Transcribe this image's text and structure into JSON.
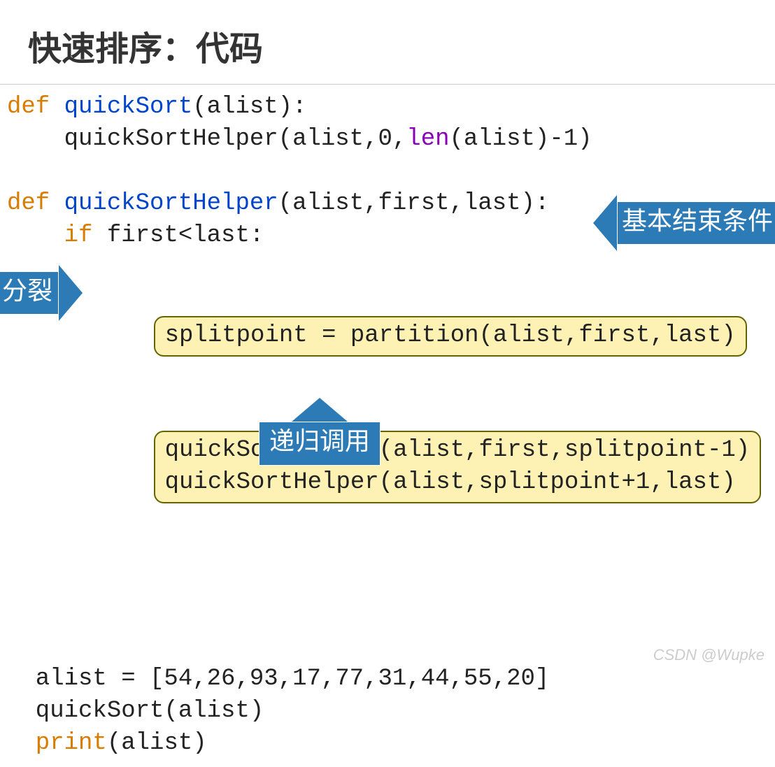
{
  "title": "快速排序：代码",
  "annotations": {
    "split": "分裂",
    "base_case": "基本结束条件",
    "recursive_call": "递归调用"
  },
  "code": {
    "l1_def": "def",
    "l1_fn": " quickSort",
    "l1_rest": "(alist):",
    "l2": "    quickSortHelper(alist,0,",
    "l2_len": "len",
    "l2_rest": "(alist)-1)",
    "l3_def": "def",
    "l3_fn": " quickSortHelper",
    "l3_rest": "(alist,first,last):",
    "l4_if": "    if ",
    "l4_rest": "first<last:",
    "l5_box": "splitpoint = partition(alist,first,last)",
    "l6_box_a": "quickSortHelper(alist,first,splitpoint-1)",
    "l6_box_b": "quickSortHelper(alist,splitpoint+1,last)",
    "l7": "  alist = [54,26,93,17,77,31,44,55,20]",
    "l8": "  quickSort(alist)",
    "l9_print": "  print",
    "l9_rest": "(alist)"
  },
  "watermark": "CSDN @Wupke"
}
